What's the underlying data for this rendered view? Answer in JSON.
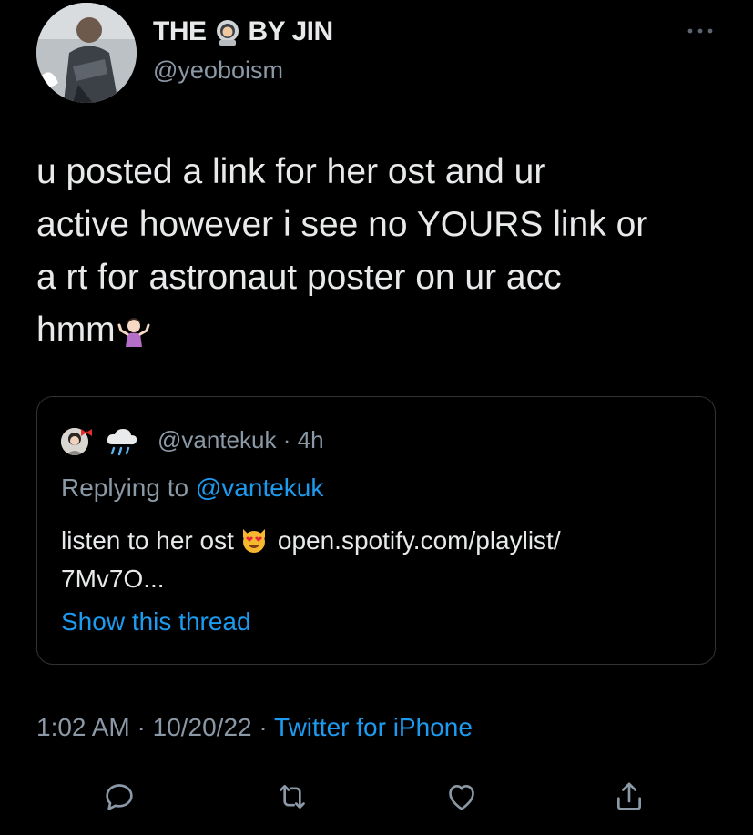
{
  "author": {
    "name_part1": "THE",
    "name_part2": "BY JIN",
    "name_emoji": "astronaut-emoji",
    "handle": "@yeoboism"
  },
  "tweet": {
    "lines": [
      "u posted a link for her ost and ur",
      "active however i see no YOURS link or",
      "a rt for astronaut poster on ur acc",
      "hmm"
    ],
    "trailing_emoji": "person-shrugging-emoji"
  },
  "quoted_tweet": {
    "handle": "@vantekuk",
    "separator": "·",
    "age": "4h",
    "replying_prefix": "Replying to",
    "replying_handle": "@vantekuk",
    "body_line1_start": "listen to her ost",
    "body_emoji": "smiling-cat-heart-eyes-emoji",
    "body_line1_link": "open.spotify.com/playlist/",
    "body_line2": "7Mv7O...",
    "show_thread": "Show this thread"
  },
  "meta": {
    "time": "1:02 AM",
    "dot1": "·",
    "date": "10/20/22",
    "dot2": "·",
    "source": "Twitter for iPhone"
  },
  "actions": [
    "reply-icon",
    "retweet-icon",
    "like-icon",
    "share-icon"
  ],
  "colors": {
    "background": "#000000",
    "text": "#e7e9ea",
    "secondary": "#8b98a5",
    "link": "#1d9bf0",
    "border": "#2f3336"
  }
}
